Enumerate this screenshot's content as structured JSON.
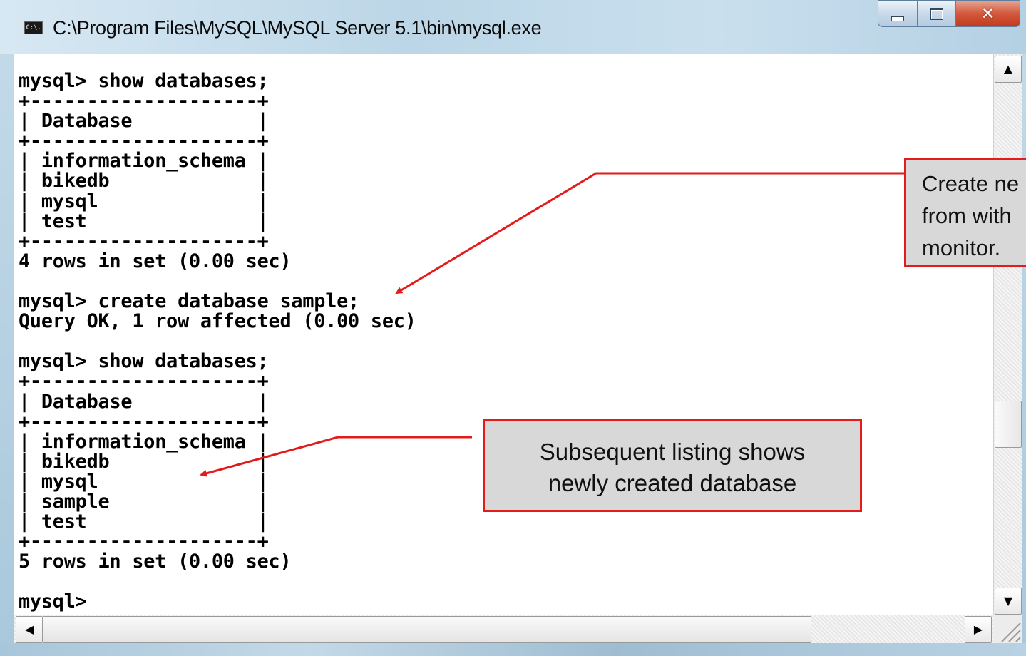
{
  "window": {
    "title": "C:\\Program Files\\MySQL\\MySQL Server 5.1\\bin\\mysql.exe",
    "icon_label": "C:\\."
  },
  "console": {
    "lines": [
      "mysql> show databases;",
      "+--------------------+",
      "| Database           |",
      "+--------------------+",
      "| information_schema |",
      "| bikedb             |",
      "| mysql              |",
      "| test               |",
      "+--------------------+",
      "4 rows in set (0.00 sec)",
      "",
      "mysql> create database sample;",
      "Query OK, 1 row affected (0.00 sec)",
      "",
      "mysql> show databases;",
      "+--------------------+",
      "| Database           |",
      "+--------------------+",
      "| information_schema |",
      "| bikedb             |",
      "| mysql              |",
      "| sample             |",
      "| test               |",
      "+--------------------+",
      "5 rows in set (0.00 sec)",
      "",
      "mysql>"
    ]
  },
  "annotations": {
    "create_callout": [
      "Create ne",
      "from with",
      "monitor."
    ],
    "subsequent_callout": [
      "Subsequent listing shows",
      "newly created database"
    ],
    "accent_color": "#e31b1b"
  },
  "scrollbars": {
    "up_icon": "scroll-up-arrow-icon",
    "down_icon": "scroll-down-arrow-icon",
    "left_icon": "scroll-left-arrow-icon",
    "right_icon": "scroll-right-arrow-icon"
  }
}
